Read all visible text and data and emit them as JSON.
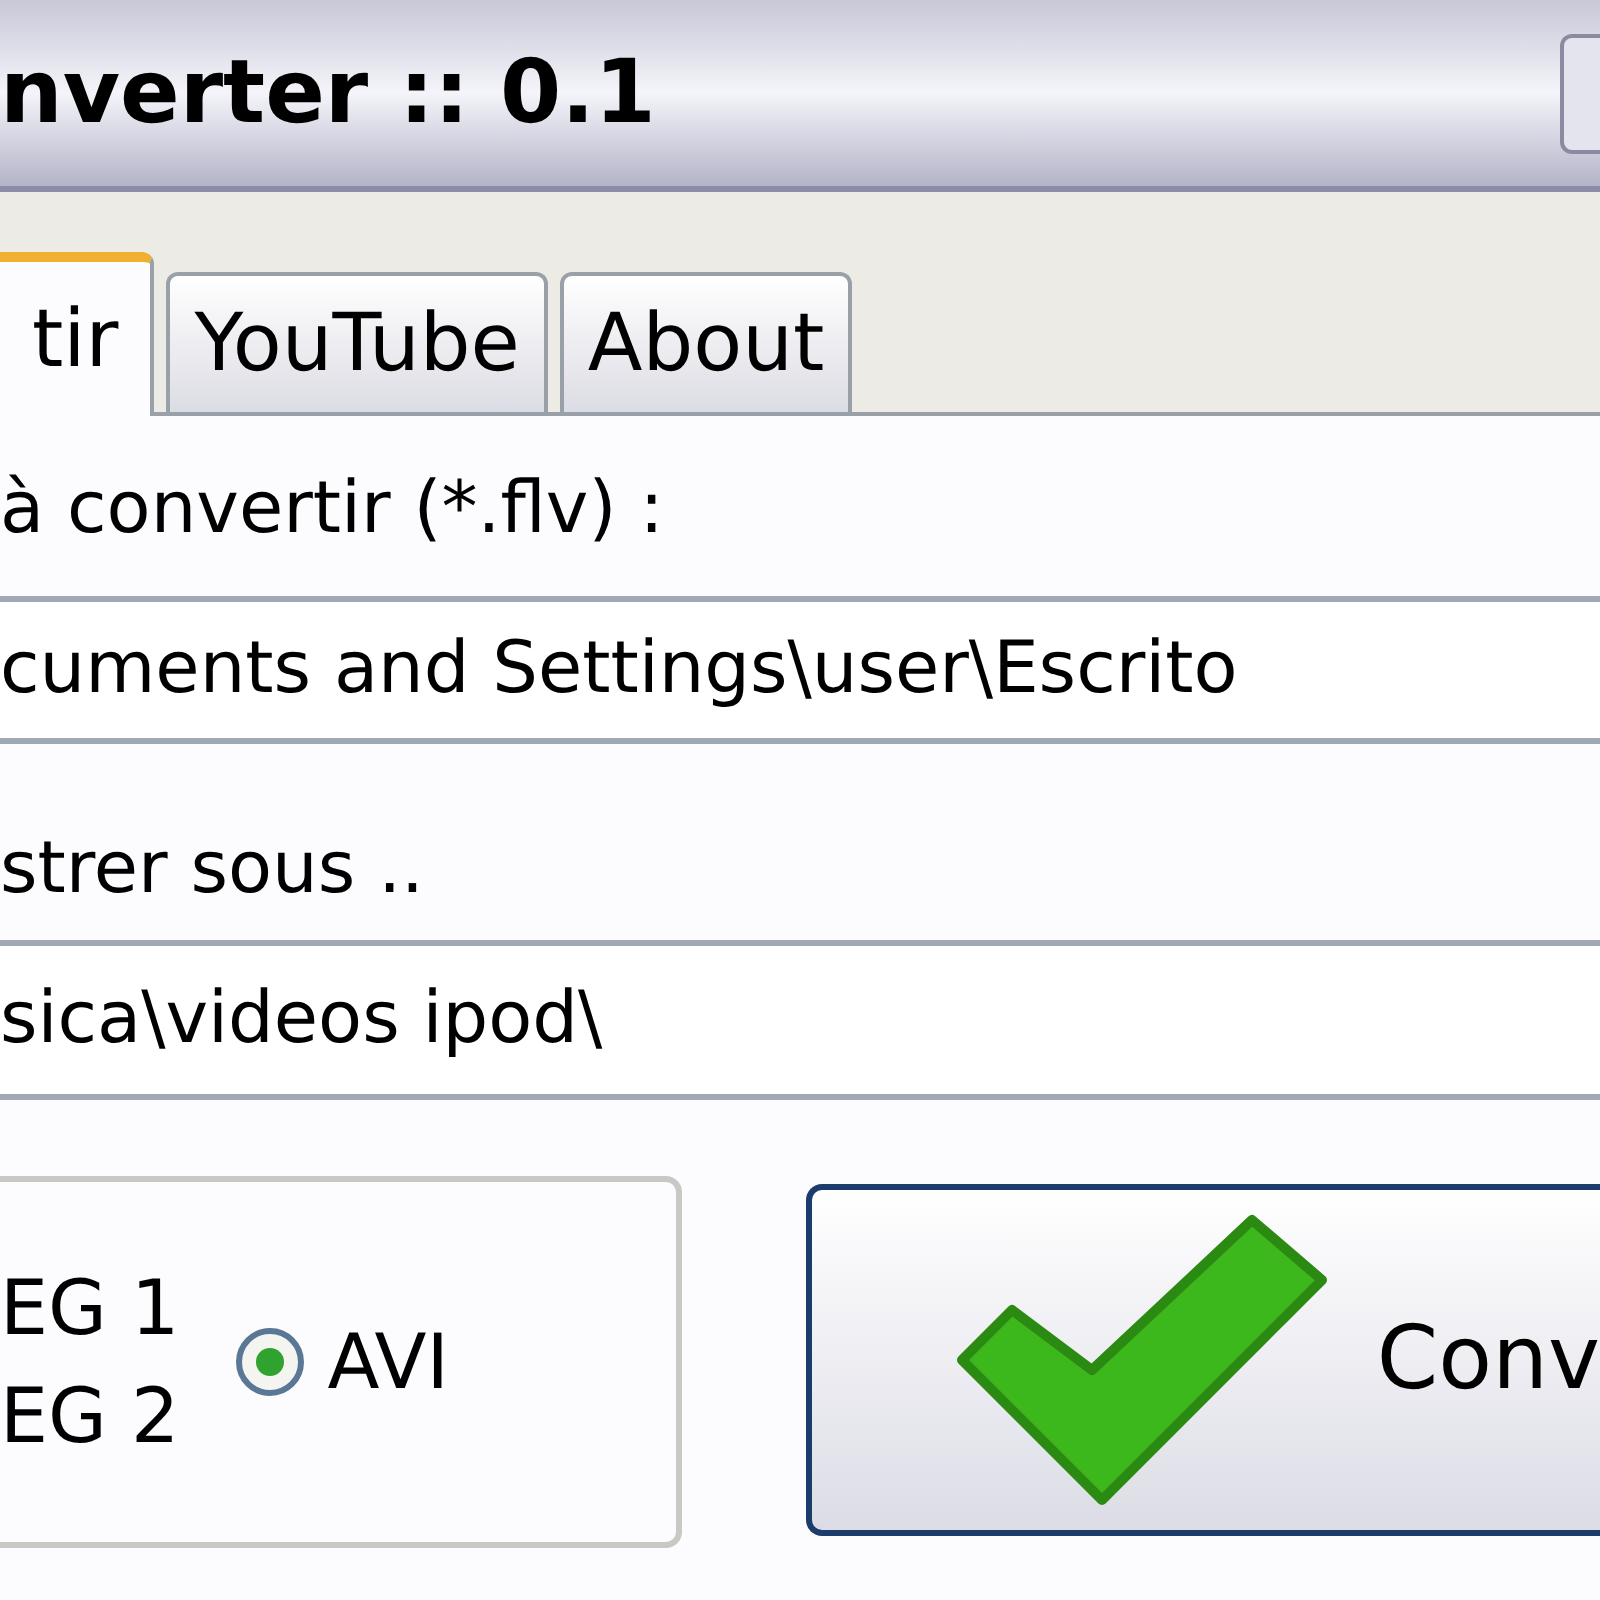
{
  "window": {
    "title": "nverter :: 0.1"
  },
  "tabs": [
    {
      "label": "tir",
      "selected": true
    },
    {
      "label": "YouTube",
      "selected": false
    },
    {
      "label": "About",
      "selected": false
    }
  ],
  "source": {
    "label": "à convertir (*.flv) :",
    "value": "cuments and Settings\\user\\Escrito"
  },
  "destination": {
    "label": "strer sous ..",
    "value": "sica\\videos ipod\\"
  },
  "format_group": {
    "options": [
      {
        "label": "EG 1"
      },
      {
        "label": "EG 2"
      },
      {
        "label": "AVI",
        "selected": true
      }
    ]
  },
  "convert_button": {
    "label": "Conv"
  }
}
